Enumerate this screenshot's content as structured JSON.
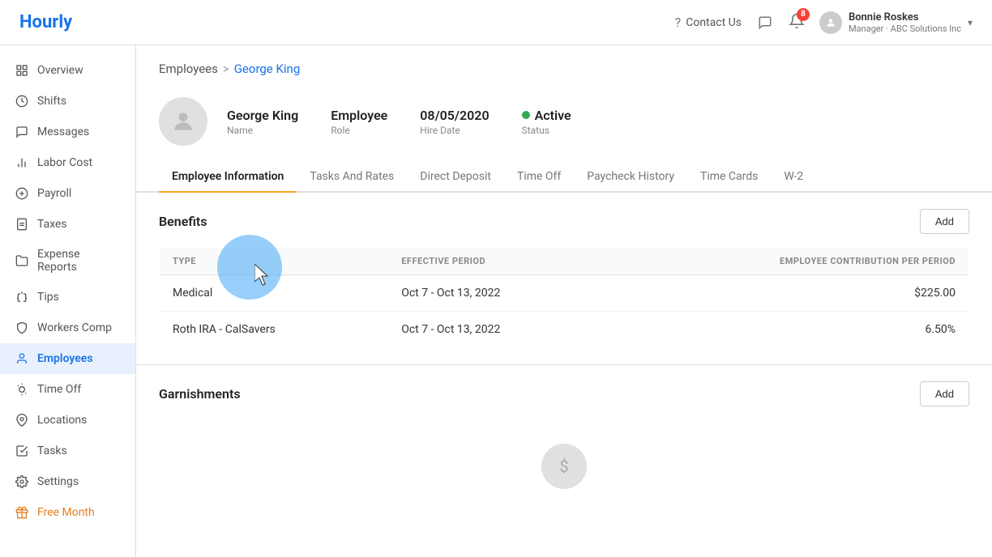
{
  "app": {
    "logo": "Hourly"
  },
  "topnav": {
    "contact_us": "Contact Us",
    "notification_count": "8",
    "user_name": "Bonnie Roskes",
    "user_role": "Manager · ABC Solutions Inc"
  },
  "sidebar": {
    "items": [
      {
        "id": "overview",
        "label": "Overview",
        "icon": "⊙"
      },
      {
        "id": "shifts",
        "label": "Shifts",
        "icon": "🕐"
      },
      {
        "id": "messages",
        "label": "Messages",
        "icon": "💬"
      },
      {
        "id": "labor-cost",
        "label": "Labor Cost",
        "icon": "📊"
      },
      {
        "id": "payroll",
        "label": "Payroll",
        "icon": "💲"
      },
      {
        "id": "taxes",
        "label": "Taxes",
        "icon": "📋"
      },
      {
        "id": "expense-reports",
        "label": "Expense Reports",
        "icon": "📁"
      },
      {
        "id": "tips",
        "label": "Tips",
        "icon": "💡"
      },
      {
        "id": "workers-comp",
        "label": "Workers Comp",
        "icon": "🛡"
      },
      {
        "id": "employees",
        "label": "Employees",
        "icon": "👤",
        "active": true
      },
      {
        "id": "time-off",
        "label": "Time Off",
        "icon": "🌴"
      },
      {
        "id": "locations",
        "label": "Locations",
        "icon": "📍"
      },
      {
        "id": "tasks",
        "label": "Tasks",
        "icon": "✓"
      },
      {
        "id": "settings",
        "label": "Settings",
        "icon": "⚙"
      },
      {
        "id": "free-month",
        "label": "Free Month",
        "icon": "🎁"
      }
    ]
  },
  "breadcrumb": {
    "parent": "Employees",
    "separator": ">",
    "current": "George King"
  },
  "employee": {
    "name": "George King",
    "name_label": "Name",
    "role": "Employee",
    "role_label": "Role",
    "hire_date": "08/05/2020",
    "hire_date_label": "Hire Date",
    "status": "Active",
    "status_label": "Status"
  },
  "tabs": [
    {
      "id": "employee-information",
      "label": "Employee Information",
      "active": true
    },
    {
      "id": "tasks-and-rates",
      "label": "Tasks And Rates"
    },
    {
      "id": "direct-deposit",
      "label": "Direct Deposit"
    },
    {
      "id": "time-off",
      "label": "Time Off"
    },
    {
      "id": "paycheck-history",
      "label": "Paycheck History"
    },
    {
      "id": "time-cards",
      "label": "Time Cards"
    },
    {
      "id": "w2",
      "label": "W-2"
    }
  ],
  "benefits": {
    "title": "Benefits",
    "add_button": "Add",
    "table": {
      "columns": [
        {
          "id": "type",
          "label": "TYPE"
        },
        {
          "id": "effective_period",
          "label": "EFFECTIVE PERIOD"
        },
        {
          "id": "contribution",
          "label": "EMPLOYEE CONTRIBUTION PER PERIOD"
        }
      ],
      "rows": [
        {
          "type": "Medical",
          "effective_period": "Oct 7 - Oct 13, 2022",
          "contribution": "$225.00"
        },
        {
          "type": "Roth IRA - CalSavers",
          "effective_period": "Oct 7 - Oct 13, 2022",
          "contribution": "6.50%"
        }
      ]
    }
  },
  "garnishments": {
    "title": "Garnishments",
    "add_button": "Add"
  }
}
